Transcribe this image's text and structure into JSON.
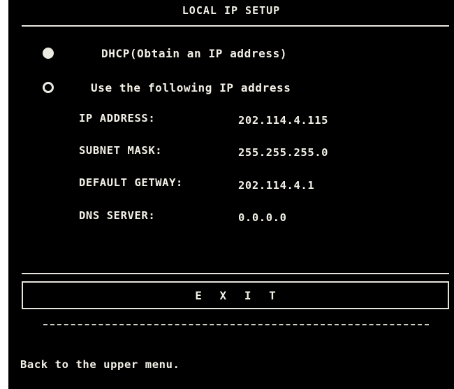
{
  "window": {
    "title": "LOCAL IP SETUP"
  },
  "ip_mode": {
    "selected": "dhcp",
    "options": [
      {
        "id": "dhcp",
        "label": "DHCP(Obtain an IP address)",
        "checked": true
      },
      {
        "id": "static",
        "label": "Use the following IP address",
        "checked": false
      }
    ]
  },
  "fields": [
    {
      "label": "IP ADDRESS:",
      "value": "202.114.4.115"
    },
    {
      "label": "SUBNET MASK:",
      "value": "255.255.255.0"
    },
    {
      "label": "DEFAULT GETWAY:",
      "value": "202.114.4.1"
    },
    {
      "label": "DNS SERVER:",
      "value": "0.0.0.0"
    }
  ],
  "exit_button": {
    "label": "E X I T"
  },
  "status_bar": {
    "text": "Back to the upper menu."
  },
  "colors": {
    "background": "#000000",
    "foreground": "#f2f0e6",
    "page": "#ffffff"
  }
}
